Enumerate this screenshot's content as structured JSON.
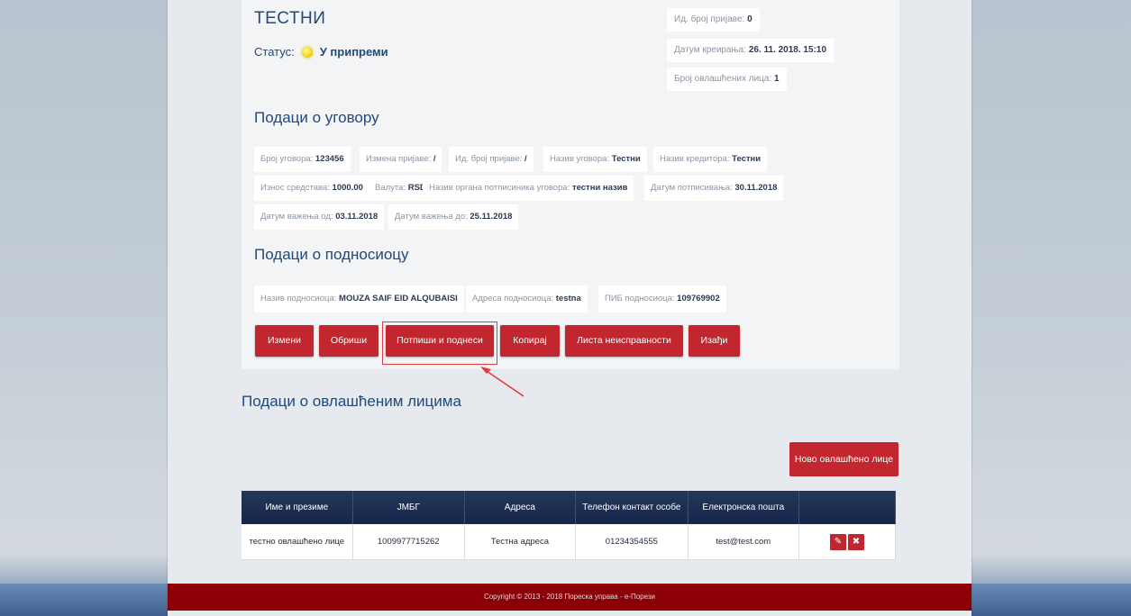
{
  "header": {
    "title": "ТЕСТНИ",
    "status_label": "Статус:",
    "status_value": "У припреми"
  },
  "meta": {
    "id_label": "Ид. број пријаве:",
    "id_value": "0",
    "created_label": "Датум креирања:",
    "created_value": "26. 11. 2018. 15:10",
    "authorized_label": "Број овлашћених лица:",
    "authorized_value": "1"
  },
  "contract": {
    "title": "Подаци о уговору",
    "fields": [
      {
        "label": "Број уговора:",
        "value": "123456"
      },
      {
        "label": "Измена пријаве:",
        "value": "/"
      },
      {
        "label": "Ид. број пријаве:",
        "value": "/"
      },
      {
        "label": "Назив уговора:",
        "value": "Тестни"
      },
      {
        "label": "Назив кредитора:",
        "value": "Тестни"
      },
      {
        "label": "Износ средстава:",
        "value": "1000.00"
      },
      {
        "label": "Валута:",
        "value": "RSD"
      },
      {
        "label": "Назив органа потписиника уговора:",
        "value": "тестни назив"
      },
      {
        "label": "Датум потписивања:",
        "value": "30.11.2018"
      },
      {
        "label": "Датум важења од:",
        "value": "03.11.2018"
      },
      {
        "label": "Датум важења до:",
        "value": "25.11.2018"
      }
    ]
  },
  "submitter": {
    "title": "Подаци о подносиоцу",
    "fields": [
      {
        "label": "Назив подносиоца:",
        "value": "MOUZA SAIF EID ALQUBAISI"
      },
      {
        "label": "Адреса подносиоца:",
        "value": "testna"
      },
      {
        "label": "ПИБ подносиоца:",
        "value": "109769902"
      }
    ]
  },
  "actions": {
    "edit": "Измени",
    "delete": "Обриши",
    "sign_submit": "Потпиши и поднеси",
    "copy": "Копирај",
    "defects": "Листа неисправности",
    "exit": "Изађи"
  },
  "authorized": {
    "title": "Подаци о овлашћеним лицима",
    "new_button": "Ново овлашћено лице",
    "columns": [
      "Име и презиме",
      "ЈМБГ",
      "Адреса",
      "Телефон контакт особе",
      "Електронска пошта",
      ""
    ],
    "rows": [
      [
        "тестно овлашћено лице",
        "1009977715262",
        "Тестна адреса",
        "01234354555",
        "test@test.com"
      ]
    ]
  },
  "footer": {
    "text": "Copyright © 2013 - 2018 Пореска управа - е-Порези"
  },
  "icons": {
    "status": "yellow-dot-icon",
    "edit_row": "pencil-icon",
    "delete_row": "close-icon"
  }
}
